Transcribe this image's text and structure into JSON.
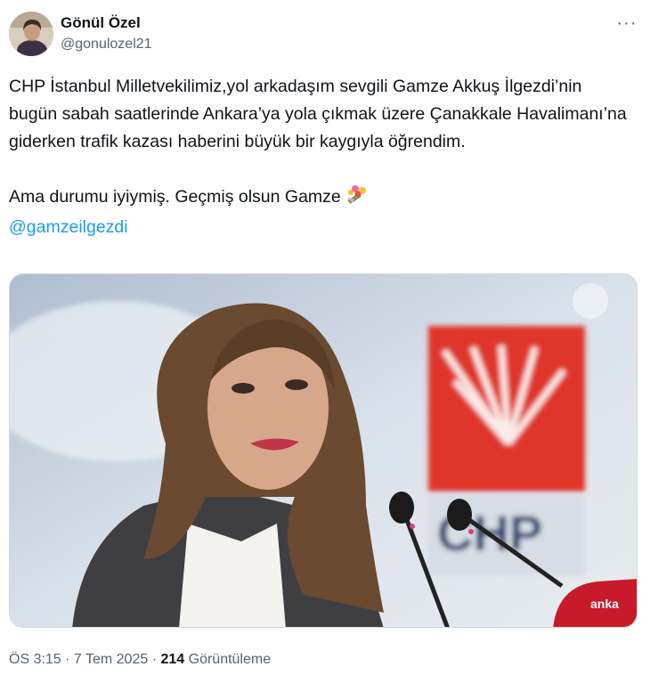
{
  "author": {
    "display_name": "Gönül Özel",
    "handle": "@gonulozel21"
  },
  "more_icon": "ellipsis-icon",
  "tweet": {
    "text_main": "CHP İstanbul Milletvekilimiz,yol arkadaşım sevgili Gamze Akkuş İlgezdi’nin bugün sabah saatlerinde Ankara’ya yola çıkmak üzere Çanakkale Havalimanı’na giderken trafik kazası haberini büyük bir kaygıyla öğrendim.",
    "text_second": "Ama durumu iyiymiş. Geçmiş olsun Gamze",
    "emoji": "bouquet-icon",
    "mention": "@gamzeilgezdi"
  },
  "media": {
    "sign_text": "CHP",
    "mic_brand": "anka"
  },
  "meta": {
    "time": "ÖS 3:15",
    "sep1": " · ",
    "date": "7 Tem 2025",
    "sep2": " · ",
    "views_count": "214",
    "views_label": " Görüntüleme"
  }
}
